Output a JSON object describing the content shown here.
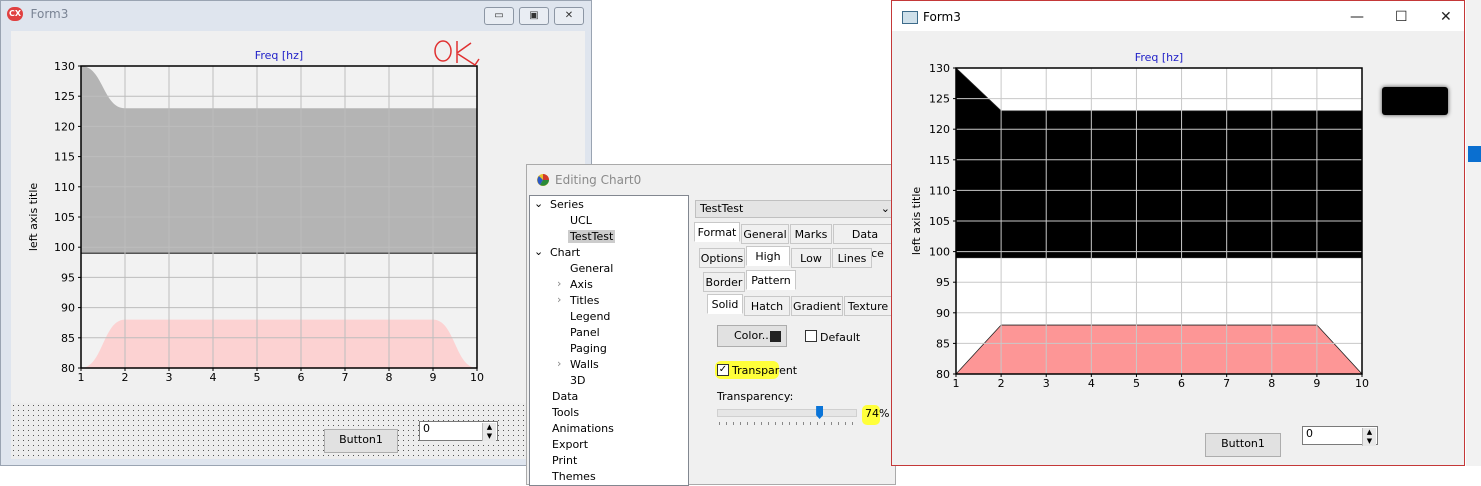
{
  "left_form": {
    "title": "Form3",
    "logo": "CX",
    "annotation": "OK",
    "button_label": "Button1",
    "spin_value": "0"
  },
  "editor": {
    "title": "Editing Chart0",
    "series_select": "TestTest",
    "tree": [
      "Series",
      "UCL",
      "TestTest",
      "Chart",
      "General",
      "Axis",
      "Titles",
      "Legend",
      "Panel",
      "Paging",
      "Walls",
      "3D",
      "Data",
      "Tools",
      "Animations",
      "Export",
      "Print",
      "Themes"
    ],
    "tabs_main": [
      "Format",
      "General",
      "Marks",
      "Data Source"
    ],
    "tabs_sub": [
      "Options",
      "High",
      "Low",
      "Lines"
    ],
    "tabs_sub2": [
      "Border",
      "Pattern"
    ],
    "tabs_fill": [
      "Solid",
      "Hatch",
      "Gradient",
      "Texture"
    ],
    "color_button": "Color...",
    "default_label": "Default",
    "transparent_label": "Transparent",
    "transparency_label": "Transparency:",
    "transparency_value": "74%",
    "transparency_fraction": 0.74
  },
  "right_form": {
    "title": "Form3",
    "button_label": "Button1",
    "spin_value": "0"
  },
  "chart_data": [
    {
      "type": "area",
      "title": "Freq [hz]",
      "ylabel": "left axis title",
      "xlim": [
        1,
        10
      ],
      "ylim": [
        80,
        130
      ],
      "x_ticks": [
        1,
        2,
        3,
        4,
        5,
        6,
        7,
        8,
        9,
        10
      ],
      "y_ticks": [
        80,
        85,
        90,
        95,
        100,
        105,
        110,
        115,
        120,
        125,
        130
      ],
      "series": [
        {
          "name": "UCL",
          "x": [
            1,
            2,
            3,
            4,
            5,
            6,
            7,
            8,
            9,
            10
          ],
          "high": [
            130,
            123,
            123,
            123,
            123,
            123,
            123,
            123,
            123,
            123
          ],
          "low": [
            99,
            99,
            99,
            99,
            99,
            99,
            99,
            99,
            99,
            99
          ],
          "color": "#b4b4b4",
          "smooth": true
        },
        {
          "name": "TestTest",
          "x": [
            1,
            2,
            3,
            4,
            5,
            6,
            7,
            8,
            9,
            10
          ],
          "high": [
            80,
            88,
            88,
            88,
            88,
            88,
            88,
            88,
            88,
            80
          ],
          "low": [
            80,
            80,
            80,
            80,
            80,
            80,
            80,
            80,
            80,
            80
          ],
          "color": "#fcd2d2",
          "smooth": true
        }
      ]
    },
    {
      "type": "area",
      "title": "Freq [hz]",
      "ylabel": "left axis title",
      "xlim": [
        1,
        10
      ],
      "ylim": [
        80,
        130
      ],
      "x_ticks": [
        1,
        2,
        3,
        4,
        5,
        6,
        7,
        8,
        9,
        10
      ],
      "y_ticks": [
        80,
        85,
        90,
        95,
        100,
        105,
        110,
        115,
        120,
        125,
        130
      ],
      "series": [
        {
          "name": "UCL",
          "x": [
            1,
            2,
            3,
            4,
            5,
            6,
            7,
            8,
            9,
            10
          ],
          "high": [
            130,
            123,
            123,
            123,
            123,
            123,
            123,
            123,
            123,
            123
          ],
          "low": [
            99,
            99,
            99,
            99,
            99,
            99,
            99,
            99,
            99,
            99
          ],
          "color": "#000000",
          "smooth": false
        },
        {
          "name": "TestTest",
          "x": [
            1,
            2,
            3,
            4,
            5,
            6,
            7,
            8,
            9,
            10
          ],
          "high": [
            80,
            88,
            88,
            88,
            88,
            88,
            88,
            88,
            88,
            80
          ],
          "low": [
            80,
            80,
            80,
            80,
            80,
            80,
            80,
            80,
            80,
            80
          ],
          "color": "#fd9696",
          "smooth": false
        }
      ]
    }
  ]
}
